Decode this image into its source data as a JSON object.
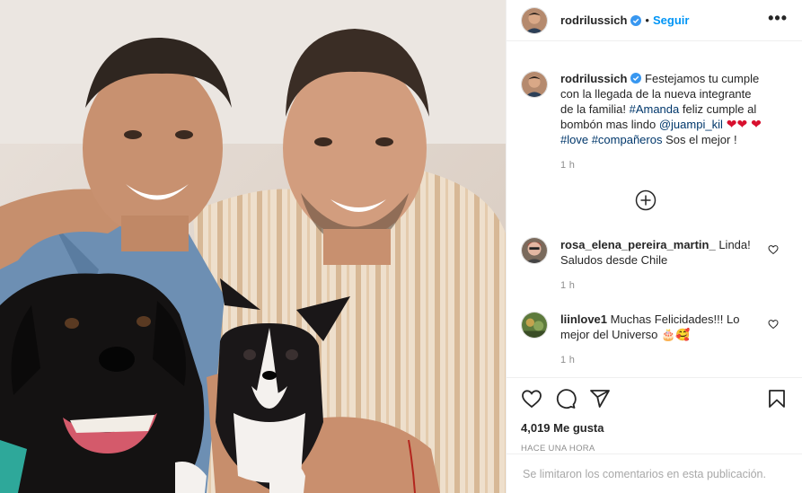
{
  "post": {
    "username": "rodrilussich",
    "separator": "•",
    "follow_label": "Seguir",
    "more_label": "•••",
    "caption": {
      "username": "rodrilussich",
      "text_1": "Festejamos tu cumple con la llegada de la nueva integrante de la familia! ",
      "hashtag_amanda": "#Amanda",
      "text_2": " feliz cumple al bombón mas lindo ",
      "mention": "@juampi_kil",
      "hearts_1": " ❤❤ ",
      "hearts_2": "❤ ",
      "hashtag_love": "#love",
      "hashtag_companeros": "#compañeros",
      "text_3": " Sos el mejor !",
      "time": "1 h"
    },
    "comments": [
      {
        "username": "rosa_elena_pereira_martin_",
        "text": " Linda! Saludos desde Chile",
        "time": "1 h"
      },
      {
        "username": "liinlove1",
        "text": " Muchas Felicidades!!! Lo mejor del Universo ",
        "emoji": "🎂🥰",
        "time": "1 h"
      }
    ],
    "likes": "4,019 Me gusta",
    "posted_ago": "HACE UNA HORA",
    "footer_text": "Se limitaron los comentarios en esta publicación."
  },
  "colors": {
    "link": "#0095f6",
    "tag": "#00376b",
    "heart": "#d8102e",
    "muted": "#8e8e8e"
  },
  "icons": [
    "verified-icon",
    "more-icon",
    "load-more-icon",
    "like-icon",
    "comment-icon",
    "share-icon",
    "save-icon"
  ]
}
